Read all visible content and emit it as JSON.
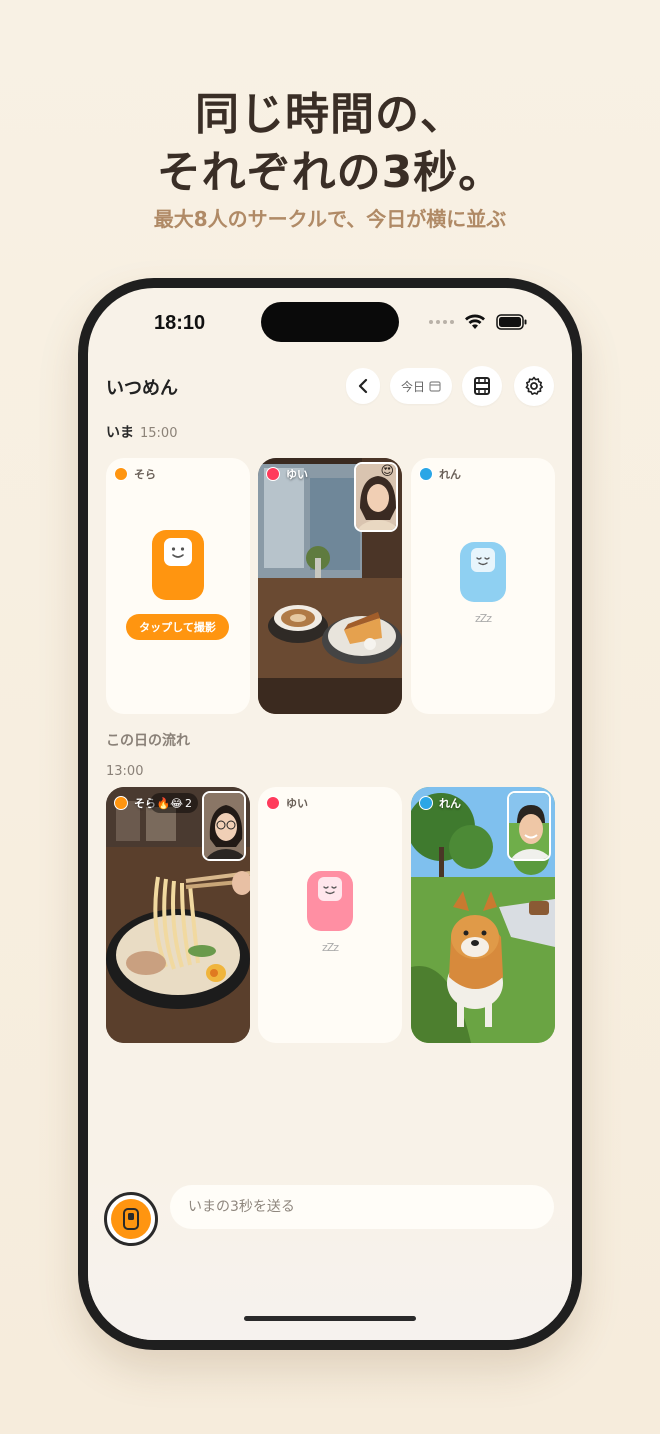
{
  "promo": {
    "headline_line1": "同じ時間の、",
    "headline_line2": "それぞれの3秒。",
    "subheadline": "最大8人のサークルで、今日が横に並ぶ"
  },
  "status_bar": {
    "time": "18:10"
  },
  "header": {
    "title": "いつめん",
    "today_label": "今日",
    "icons": [
      "back-icon",
      "calendar-icon",
      "film-icon",
      "gear-icon"
    ]
  },
  "now_section": {
    "label": "いま",
    "time": "15:00",
    "cards": [
      {
        "name": "そら",
        "color": "#ff9510",
        "state": "capture",
        "cta": "タップして撮影"
      },
      {
        "name": "ゆい",
        "color": "#ff3b5c",
        "state": "photo",
        "inset_emoji": "😍"
      },
      {
        "name": "れん",
        "color": "#2aa6e6",
        "state": "sleeping",
        "zzz": "zZz"
      }
    ]
  },
  "flow_section": {
    "label": "この日の流れ",
    "time": "13:00",
    "cards": [
      {
        "name": "そら",
        "color": "#ff9510",
        "state": "photo",
        "reactions": "🔥😂",
        "reaction_count": "2"
      },
      {
        "name": "ゆい",
        "color": "#ff3b5c",
        "state": "sleeping",
        "zzz": "zZz"
      },
      {
        "name": "れん",
        "color": "#2aa6e6",
        "state": "photo"
      }
    ]
  },
  "composer": {
    "placeholder": "いまの3秒を送る"
  },
  "colors": {
    "accent": "#ff9510",
    "background": "#f8f2e8",
    "yui": "#ff3b5c",
    "ren": "#2aa6e6",
    "mascot_blue": "#8fd0f2",
    "mascot_pink": "#ff8fa3"
  }
}
